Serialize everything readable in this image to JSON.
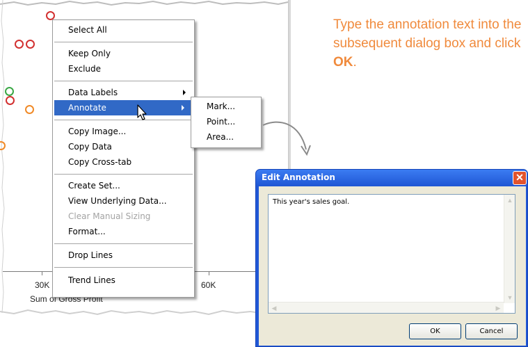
{
  "chart": {
    "x_ticks": [
      "30K",
      "60K"
    ],
    "x_axis_title": "Sum of Gross Profit"
  },
  "context_menu": {
    "items": [
      {
        "label": "Select All"
      },
      {
        "label": "Keep Only"
      },
      {
        "label": "Exclude"
      },
      {
        "label": "Data Labels"
      },
      {
        "label": "Annotate"
      },
      {
        "label": "Copy Image..."
      },
      {
        "label": "Copy Data"
      },
      {
        "label": "Copy Cross-tab"
      },
      {
        "label": "Create Set..."
      },
      {
        "label": "View Underlying Data..."
      },
      {
        "label": "Clear Manual Sizing"
      },
      {
        "label": "Format..."
      },
      {
        "label": "Drop Lines"
      },
      {
        "label": "Trend Lines"
      }
    ],
    "active_item": "Annotate",
    "disabled_item": "Clear Manual Sizing"
  },
  "annotate_submenu": {
    "items": [
      "Mark...",
      "Point...",
      "Area..."
    ]
  },
  "instruction": {
    "prefix": "Type the annotation text into the subsequent dialog box and click ",
    "bold": "OK",
    "suffix": "."
  },
  "dialog": {
    "title": "Edit Annotation",
    "close_glyph": "✕",
    "text": "This year's sales goal.",
    "ok_label": "OK",
    "cancel_label": "Cancel"
  },
  "colors": {
    "highlight": "#3169c6",
    "instruction": "#f08a3c",
    "mark_red": "#d23030",
    "mark_orange": "#f08a28",
    "mark_green": "#3aa845",
    "titlebar": "#2057d6"
  }
}
